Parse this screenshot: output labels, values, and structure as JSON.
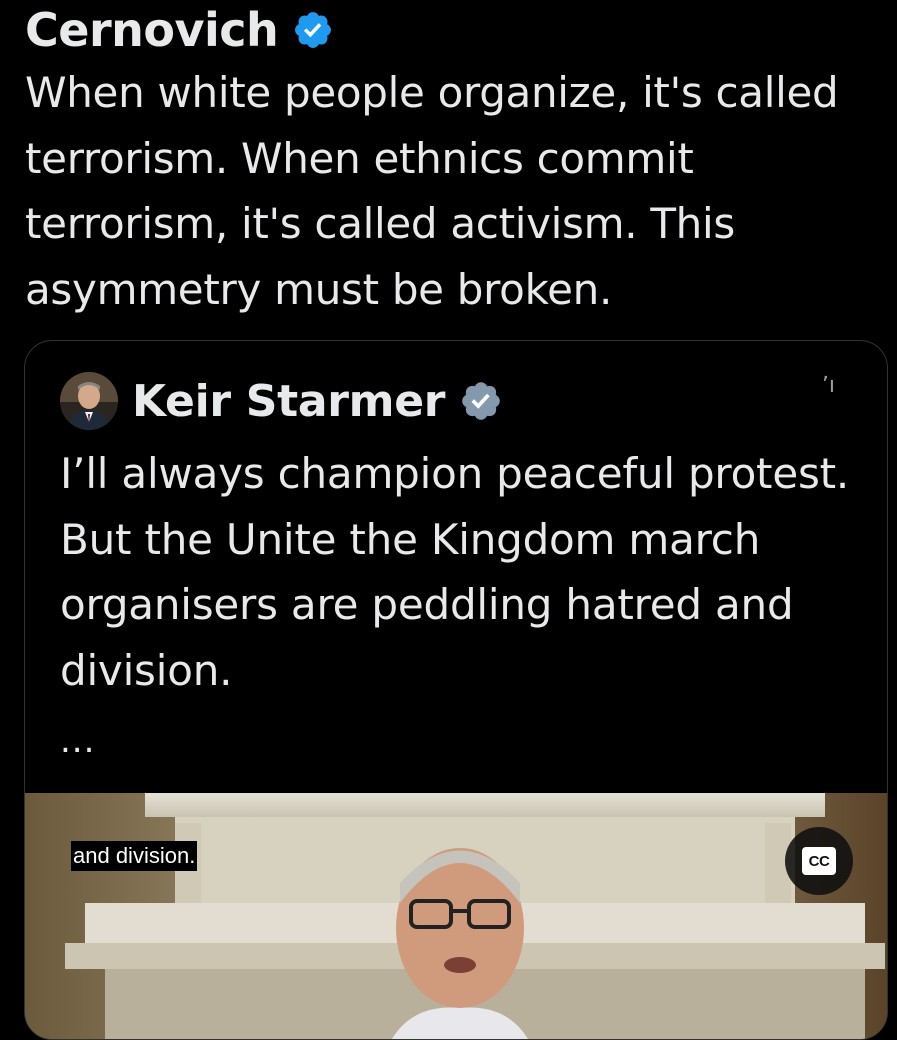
{
  "tweet": {
    "author": "Cernovich",
    "text": "When white people organize, it's called terrorism. When ethnics commit terrorism, it's called activism. This asymmetry must be broken."
  },
  "quote": {
    "author": "Keir Starmer",
    "text": "I’ll always champion peaceful protest. But the Unite the Kingdom march organisers are peddling hatred and division.",
    "ellipsis": "...",
    "more_glyph": "ʼı",
    "video": {
      "caption": "and division.",
      "cc_label": "CC"
    }
  },
  "colors": {
    "background": "#000000",
    "text": "#e7e9ea",
    "verified_blue": "#1d9bf0",
    "verified_grey": "#829aab",
    "border": "#2f3336"
  },
  "icons": {
    "verified_badge": "verified-badge-icon",
    "verified_badge_grey": "verified-badge-grey-icon",
    "closed_captions": "cc-icon"
  }
}
